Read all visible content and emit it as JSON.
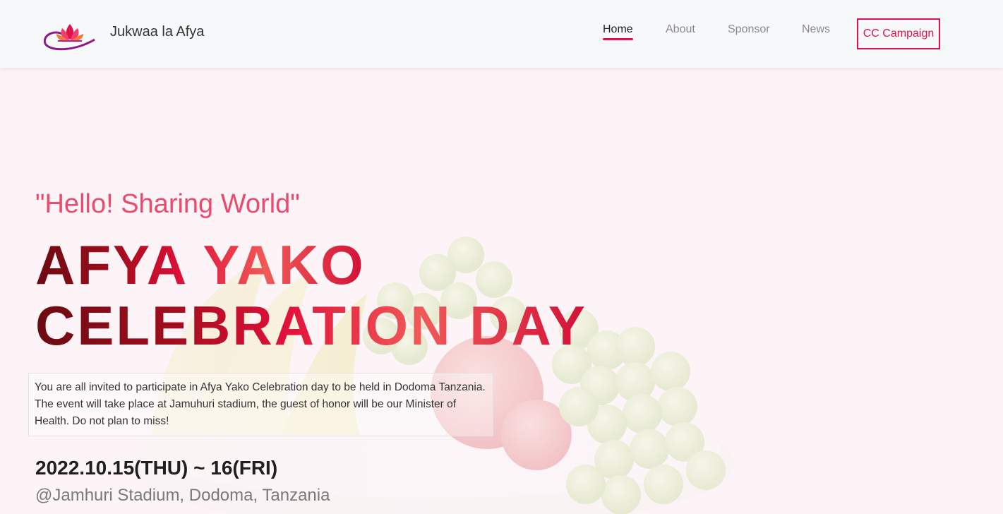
{
  "brand": {
    "name": "Jukwaa la Afya",
    "logo_icon": "lotus-logo-icon"
  },
  "nav": {
    "items": [
      {
        "label": "Home",
        "active": true
      },
      {
        "label": "About",
        "active": false
      },
      {
        "label": "Sponsor",
        "active": false
      },
      {
        "label": "News",
        "active": false
      }
    ],
    "cta_label": "CC Campaign"
  },
  "hero": {
    "tagline": "\"Hello! Sharing World\"",
    "title_line1": "AFYA YAKO",
    "title_line2": "CELEBRATION DAY",
    "description": "You are all invited to participate in Afya Yako Celebration day to be held in Dodoma Tanzania. The event will take place at Jamuhuri stadium, the guest of honor will be our Minister of Health. Do not plan to miss!",
    "date": "2022.10.15(THU) ~ 16(FRI)",
    "venue": "@Jamhuri Stadium, Dodoma, Tanzania",
    "background_image": "fruit-bowl-image"
  },
  "colors": {
    "accent": "#e0124a",
    "tagline": "#ec4a6e",
    "title_dark": "#6b0a12",
    "title_red": "#e1103a"
  }
}
